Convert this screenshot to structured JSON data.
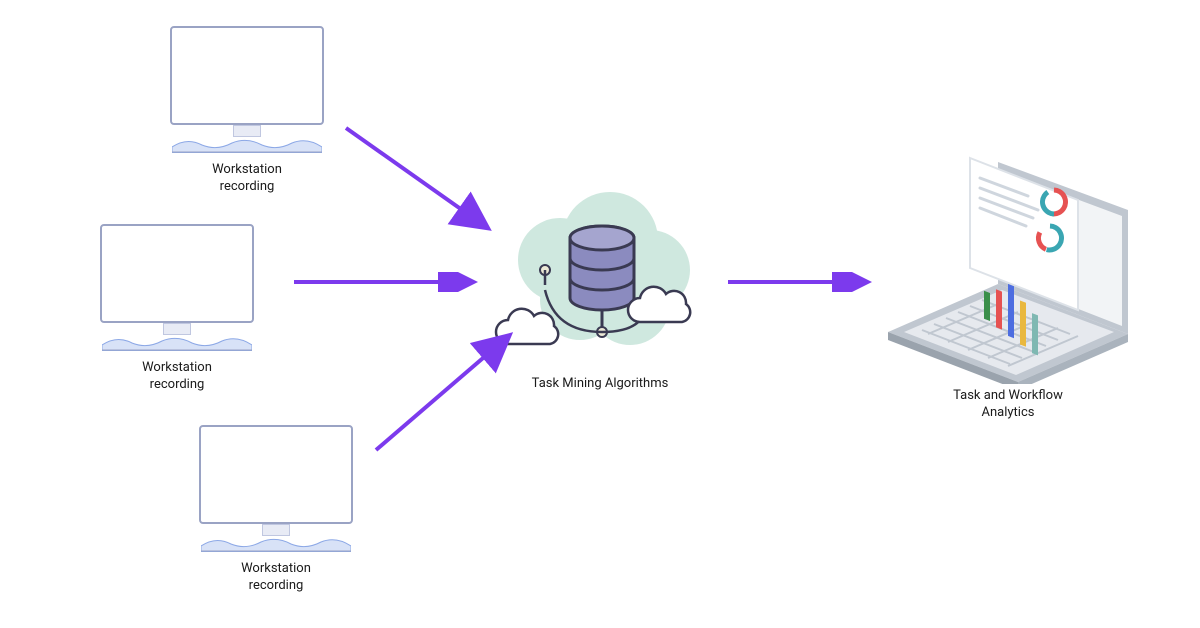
{
  "nodes": {
    "ws1": {
      "label": "Workstation\nrecording"
    },
    "ws2": {
      "label": "Workstation\nrecording"
    },
    "ws3": {
      "label": "Workstation\nrecording"
    },
    "center": {
      "label": "Task Mining Algorithms"
    },
    "right": {
      "label": "Task and Workflow\nAnalytics"
    }
  },
  "colors": {
    "arrow": "#7c3aed",
    "cloud_bg": "#cfe8df",
    "db_body": "#8b8bbf",
    "db_stroke": "#3a3a52",
    "small_cloud": "#ffffff",
    "small_cloud_stroke": "#3a3a52",
    "monitor_stroke": "#9aa3c4",
    "monitor_wave": "#8ca8e6",
    "laptop_body": "#e6e9ee",
    "laptop_body_dark": "#c0c7d0",
    "laptop_screen": "#f2f4f6",
    "paper": "#ffffff",
    "paper_stroke": "#dde2e8",
    "bar1": "#3a8f4a",
    "bar2": "#e65252",
    "bar3": "#4d6de0",
    "bar4": "#e9b83e",
    "bar5": "#7fb8b2",
    "ring_a": "#e65252",
    "ring_b": "#3aa6b2"
  }
}
